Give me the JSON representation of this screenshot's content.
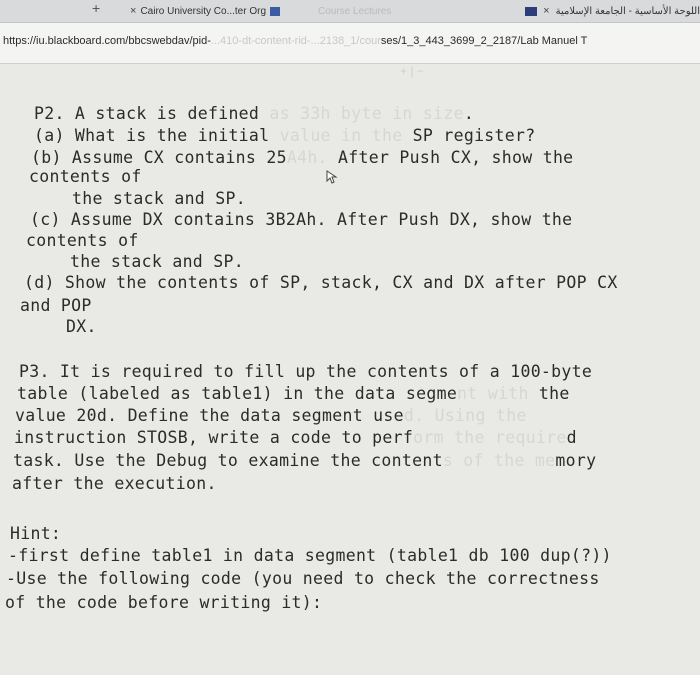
{
  "browser": {
    "new_tab_glyph": "+",
    "tabs": [
      {
        "close": "×",
        "label": "Cairo University Co...ter Org"
      },
      {
        "label": "Course Lectures"
      },
      {
        "close": "×",
        "label": "اللوحة الأساسية - الجامعة الإسلامية"
      }
    ],
    "address": {
      "url_start": "https://iu.blackboard.com/bbcswebdav/pid-",
      "url_faded": "...410-dt-content-rid-...2138_1/cour",
      "url_end": "ses/1_3_443_3699_2_2187/Lab Manuel T"
    }
  },
  "document": {
    "p2": {
      "line1_a": "P2. A stack is defined ",
      "line1_glare": "as 33h byte in size",
      "line1_b": ".",
      "line2_a": "(a) What is the initial ",
      "line2_glare": "value in the",
      "line2_b": " SP register?",
      "line3_a": "(b) Assume CX contains 25",
      "line3_glare": "A4h.",
      "line3_b": " After Push CX, show the",
      "line4": "contents of",
      "line5": "the stack and SP.",
      "line6": "(c) Assume DX contains 3B2Ah. After Push DX, show the",
      "line7": "contents of",
      "line8": "the stack and SP.",
      "line9": "(d) Show the contents of SP, stack, CX and DX after POP CX",
      "line10": "and POP",
      "line11": "DX."
    },
    "p3": {
      "line1": "P3. It is required to fill up the contents of a 100-byte",
      "line2_a": "table (labeled as table1) in the data segme",
      "line2_glare": "nt with",
      "line2_b": " the",
      "line3_a": "value 20d. Define the data segment use",
      "line3_glare": "d. Using the",
      "line4_a": "instruction STOSB, write a code to perf",
      "line4_glare": "orm the require",
      "line4_b": "d",
      "line5_a": "task. Use the Debug to examine the content",
      "line5_glare": "s of the me",
      "line5_b": "mory",
      "line6": "after the execution."
    },
    "hint": {
      "title": "Hint:",
      "line1": "-first define table1 in data segment (table1 db 100 dup(?))",
      "line2": "-Use the following code (you need to check the correctness",
      "line3": "of the code before writing it):"
    }
  }
}
